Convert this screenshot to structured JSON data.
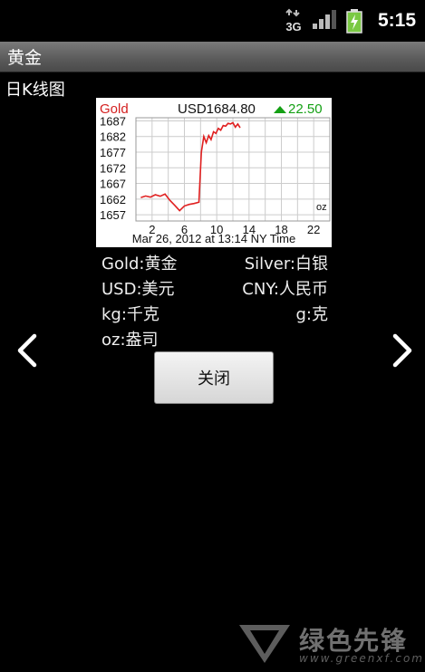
{
  "status_bar": {
    "network": "3G",
    "time": "5:15"
  },
  "title_bar": {
    "title": "黄金"
  },
  "subtitle": "日K线图",
  "chart": {
    "label": "Gold",
    "price": "USD1684.80",
    "change": "22.50",
    "unit": "oz",
    "footer": "Mar 26, 2012 at 13:14 NY Time",
    "colors": {
      "label": "#d42020",
      "change": "#14a014",
      "line": "#e02020",
      "grid": "#cccccc"
    }
  },
  "chart_data": {
    "type": "line",
    "title": "Gold",
    "x_ticks": [
      "2",
      "6",
      "10",
      "14",
      "18",
      "22"
    ],
    "y_ticks": [
      "1687",
      "1682",
      "1677",
      "1672",
      "1667",
      "1662",
      "1657"
    ],
    "ylim": [
      1655,
      1688
    ],
    "xlim": [
      0,
      24
    ],
    "grid": true,
    "series": [
      {
        "name": "Gold",
        "x": [
          0.6,
          1.2,
          1.8,
          2.4,
          3.0,
          3.6,
          4.2,
          4.8,
          5.4,
          6.0,
          6.6,
          7.2,
          7.8,
          8.1,
          8.4,
          8.7,
          9.0,
          9.3,
          9.6,
          9.9,
          10.2,
          10.5,
          10.8,
          11.1,
          11.4,
          11.7,
          12.0,
          12.3,
          12.6,
          12.9
        ],
        "y": [
          1662.5,
          1663.0,
          1662.6,
          1663.4,
          1662.9,
          1663.6,
          1661.6,
          1660.0,
          1658.3,
          1659.8,
          1660.3,
          1660.6,
          1661.0,
          1677.0,
          1682.0,
          1680.0,
          1682.3,
          1681.0,
          1683.5,
          1683.0,
          1684.6,
          1684.0,
          1685.5,
          1685.3,
          1686.2,
          1686.0,
          1686.4,
          1685.0,
          1686.0,
          1684.8
        ]
      }
    ]
  },
  "glossary": [
    {
      "left": "Gold:黄金",
      "right": "Silver:白银"
    },
    {
      "left": "USD:美元",
      "right": "CNY:人民币"
    },
    {
      "left": "kg:千克",
      "right": "g:克"
    },
    {
      "left": "oz:盎司",
      "right": ""
    }
  ],
  "buttons": {
    "close": "关闭"
  },
  "watermark": {
    "text": "绿色先锋",
    "url": "www.greenxf.com"
  }
}
